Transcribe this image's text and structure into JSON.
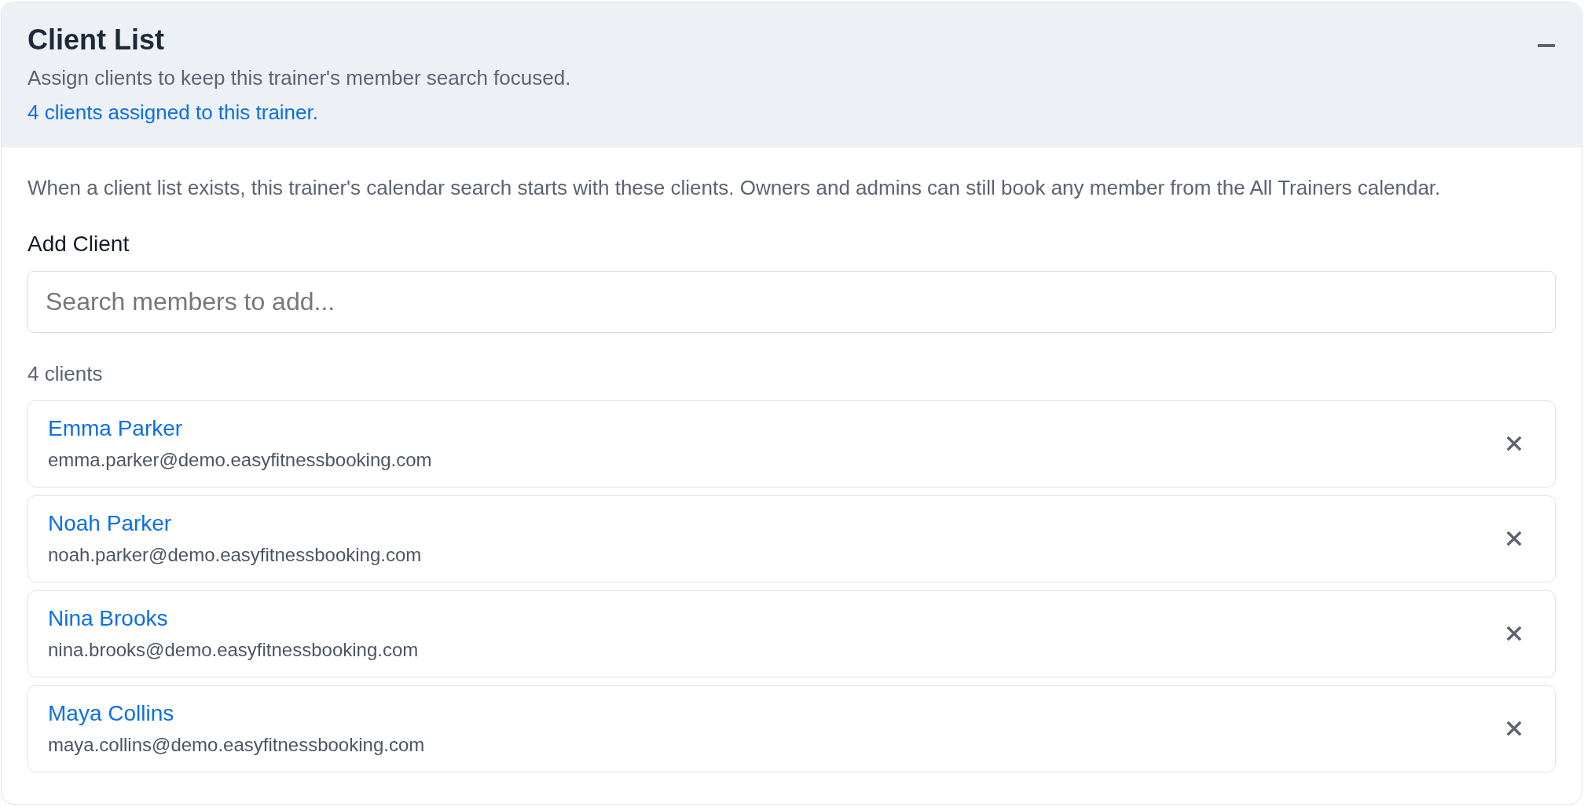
{
  "panel": {
    "title": "Client List",
    "subtitle": "Assign clients to keep this trainer's member search focused.",
    "assigned_note": "4 clients assigned to this trainer.",
    "expanded": true
  },
  "body": {
    "description": "When a client list exists, this trainer's calendar search starts with these clients. Owners and admins can still book any member from the All Trainers calendar.",
    "add_client": {
      "label": "Add Client",
      "placeholder": "Search members to add..."
    },
    "count": "4 clients",
    "clients": [
      {
        "name": "Emma Parker",
        "email": "emma.parker@demo.easyfitnessbooking.com"
      },
      {
        "name": "Noah Parker",
        "email": "noah.parker@demo.easyfitnessbooking.com"
      },
      {
        "name": "Nina Brooks",
        "email": "nina.brooks@demo.easyfitnessbooking.com"
      },
      {
        "name": "Maya Collins",
        "email": "maya.collins@demo.easyfitnessbooking.com"
      }
    ]
  }
}
